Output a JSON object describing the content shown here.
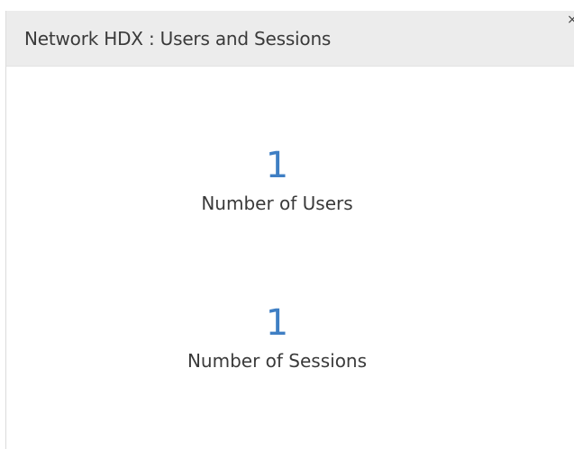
{
  "panel": {
    "title": "Network HDX : Users and Sessions",
    "close_icon": "close-icon",
    "close_glyph": "×"
  },
  "metrics": [
    {
      "value": "1",
      "label": "Number of Users"
    },
    {
      "value": "1",
      "label": "Number of Sessions"
    }
  ],
  "colors": {
    "header_bg": "#ececec",
    "value_blue": "#3f7fc4",
    "text": "#3a3a3a"
  }
}
